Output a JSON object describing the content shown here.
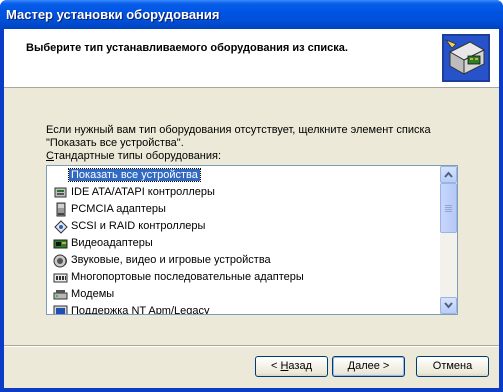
{
  "window": {
    "title": "Мастер установки оборудования"
  },
  "header": {
    "title": "Выберите тип устанавливаемого оборудования из списка."
  },
  "instructions": "Если нужный вам тип оборудования отсутствует, щелкните элемент списка \"Показать все устройства\".",
  "list": {
    "caption_prefix": "",
    "caption_underlined": "С",
    "caption_rest": "тандартные типы оборудования:",
    "items": [
      {
        "label": "Показать все устройства",
        "icon": "blank-icon",
        "selected": true
      },
      {
        "label": "IDE ATA/ATAPI контроллеры",
        "icon": "ide-controller-icon"
      },
      {
        "label": "PCMCIA адаптеры",
        "icon": "pcmcia-icon"
      },
      {
        "label": "SCSI и RAID контроллеры",
        "icon": "scsi-icon"
      },
      {
        "label": "Видеоадаптеры",
        "icon": "display-adapter-icon"
      },
      {
        "label": "Звуковые, видео и игровые устройства",
        "icon": "sound-icon"
      },
      {
        "label": "Многопортовые последовательные адаптеры",
        "icon": "multiport-icon"
      },
      {
        "label": "Модемы",
        "icon": "modem-icon"
      },
      {
        "label": "Поддержка NT Apm/Legacy",
        "icon": "nt-apm-icon"
      }
    ]
  },
  "buttons": {
    "back": {
      "pre": "< ",
      "key": "Н",
      "rest": "азад"
    },
    "next": {
      "pre": "",
      "key": "Д",
      "rest": "алее >"
    },
    "cancel": "Отмена"
  },
  "colors": {
    "selection": "#316ac5",
    "face": "#ece9d8",
    "title": "#0054e3"
  }
}
